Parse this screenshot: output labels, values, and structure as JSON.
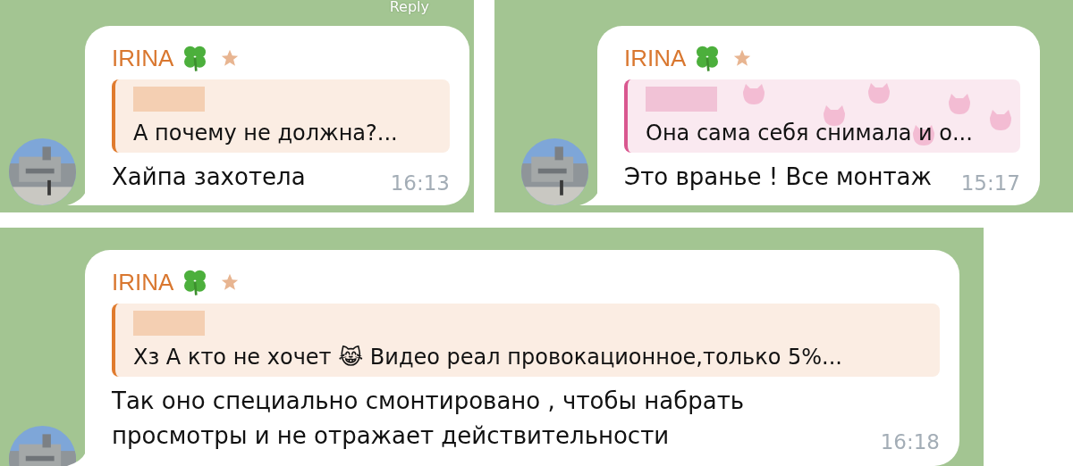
{
  "messages": [
    {
      "sender": "IRINA",
      "hover_label": "Reply",
      "quote": {
        "kind": "plain",
        "color": "#e07b2e",
        "text": "А почему не должна?..."
      },
      "text": "Хайпа захотела",
      "time": "16:13"
    },
    {
      "sender": "IRINA",
      "quote": {
        "kind": "pattern",
        "color": "#d9578f",
        "text": "Она сама себя снимала и о..."
      },
      "text": "Это вранье ! Все монтаж",
      "time": "15:17"
    },
    {
      "sender": "IRINA",
      "quote": {
        "kind": "plain",
        "color": "#e07b2e",
        "text": "Хз А кто не хочет 😹 Видео реал провокационное,только 5%..."
      },
      "text": "Так оно специально смонтировано , чтобы набрать просмотры и не отражает действительности",
      "time": "16:18"
    }
  ]
}
